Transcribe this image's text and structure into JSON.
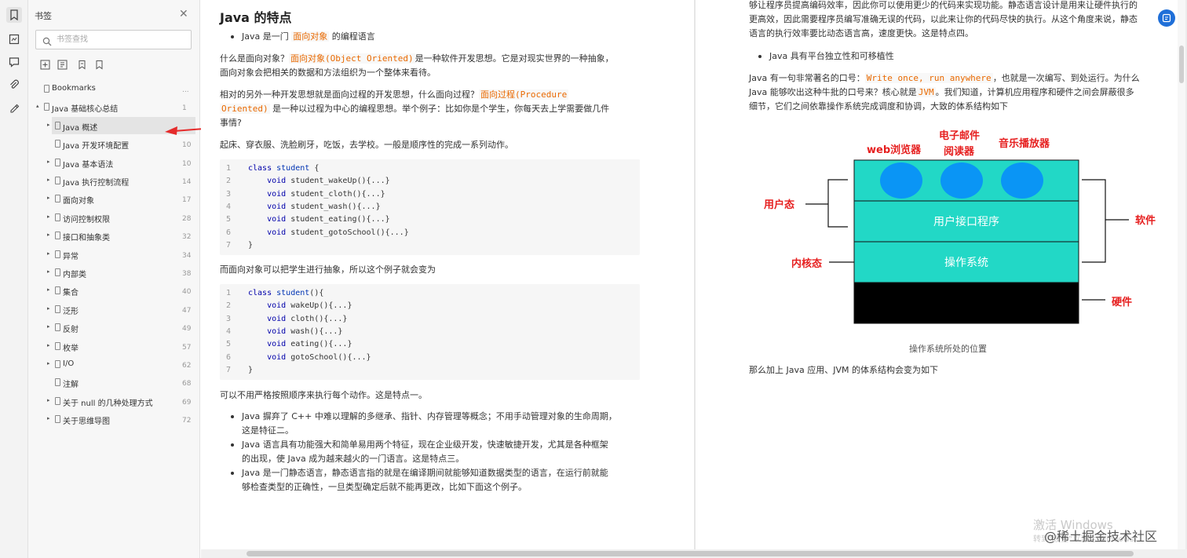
{
  "sidebar": {
    "title": "书签",
    "search_placeholder": "书签查找",
    "items": [
      {
        "label": "Bookmarks",
        "page": "...",
        "level": 0,
        "expand": ""
      },
      {
        "label": "Java 基础核心总结",
        "page": "1",
        "level": 0,
        "expand": "▴"
      },
      {
        "label": "Java 概述",
        "page": "",
        "level": 1,
        "expand": "▸",
        "selected": true
      },
      {
        "label": "Java 开发环境配置",
        "page": "10",
        "level": 1,
        "expand": ""
      },
      {
        "label": "Java 基本语法",
        "page": "10",
        "level": 1,
        "expand": "▸"
      },
      {
        "label": "Java 执行控制流程",
        "page": "14",
        "level": 1,
        "expand": "▸"
      },
      {
        "label": "面向对象",
        "page": "17",
        "level": 1,
        "expand": "▸"
      },
      {
        "label": "访问控制权限",
        "page": "28",
        "level": 1,
        "expand": "▸"
      },
      {
        "label": "接口和抽象类",
        "page": "32",
        "level": 1,
        "expand": "▸"
      },
      {
        "label": "异常",
        "page": "34",
        "level": 1,
        "expand": "▸"
      },
      {
        "label": "内部类",
        "page": "38",
        "level": 1,
        "expand": "▸"
      },
      {
        "label": "集合",
        "page": "40",
        "level": 1,
        "expand": "▸"
      },
      {
        "label": "泛形",
        "page": "47",
        "level": 1,
        "expand": "▸"
      },
      {
        "label": "反射",
        "page": "49",
        "level": 1,
        "expand": "▸"
      },
      {
        "label": "枚举",
        "page": "57",
        "level": 1,
        "expand": "▸"
      },
      {
        "label": "I/O",
        "page": "62",
        "level": 1,
        "expand": "▸"
      },
      {
        "label": "注解",
        "page": "68",
        "level": 1,
        "expand": ""
      },
      {
        "label": "关于 null 的几种处理方式",
        "page": "69",
        "level": 1,
        "expand": "▸"
      },
      {
        "label": "关于思维导图",
        "page": "72",
        "level": 1,
        "expand": "▸"
      }
    ]
  },
  "left_page": {
    "heading": "Java 的特点",
    "b1_pre": "Java 是一门",
    "b1_hi": "面向对象",
    "b1_post": "的编程语言",
    "p1_pre": "什么是面向对象？",
    "p1_hi": "面向对象(Object Oriented)",
    "p1_post": "是一种软件开发思想。它是对现实世界的一种抽象，",
    "p1_line2": "面向对象会把相关的数据和方法组织为一个整体来看待。",
    "p2_pre": "相对的另外一种开发思想就是面向过程的开发思想，什么面向过程？",
    "p2_hi1": "面向过程(Procedure",
    "p2_hi2": "Oriented)",
    "p2_post": "是一种以过程为中心的编程思想。举个例子：比如你是个学生，你每天去上学需要做几件",
    "p2_line3": "事情?",
    "p3": "起床、穿衣服、洗脸刷牙，吃饭，去学校。一般是顺序性的完成一系列动作。",
    "code1": [
      {
        "n": "1",
        "t": "class student {"
      },
      {
        "n": "2",
        "t": "    void student_wakeUp(){...}"
      },
      {
        "n": "3",
        "t": "    void student_cloth(){...}"
      },
      {
        "n": "4",
        "t": "    void student_wash(){...}"
      },
      {
        "n": "5",
        "t": "    void student_eating(){...}"
      },
      {
        "n": "6",
        "t": "    void student_gotoSchool(){...}"
      },
      {
        "n": "7",
        "t": "}"
      }
    ],
    "p4": "而面向对象可以把学生进行抽象，所以这个例子就会变为",
    "code2": [
      {
        "n": "1",
        "t": "class student(){"
      },
      {
        "n": "2",
        "t": "    void wakeUp(){...}"
      },
      {
        "n": "3",
        "t": "    void cloth(){...}"
      },
      {
        "n": "4",
        "t": "    void wash(){...}"
      },
      {
        "n": "5",
        "t": "    void eating(){...}"
      },
      {
        "n": "6",
        "t": "    void gotoSchool(){...}"
      },
      {
        "n": "7",
        "t": "}"
      }
    ],
    "p5": "可以不用严格按照顺序来执行每个动作。这是特点一。",
    "b2_l1": "Java 摒弃了 C++ 中难以理解的多继承、指针、内存管理等概念；不用手动管理对象的生命周期，",
    "b2_l2": "这是特征二。",
    "b3_l1": "Java 语言具有功能强大和简单易用两个特征，现在企业级开发，快速敏捷开发，尤其是各种框架",
    "b3_l2": "的出现，使 Java 成为越来越火的一门语言。这是特点三。",
    "b4_l1": "Java 是一门静态语言，静态语言指的就是在编译期间就能够知道数据类型的语言，在运行前就能",
    "b4_l2": "够检查类型的正确性，一旦类型确定后就不能再更改，比如下面这个例子。"
  },
  "right_page": {
    "top_l1": "够让程序员提高编码效率，因此你可以使用更少的代码来实现功能。静态语言设计是用来让硬件执行的",
    "top_l2": "更高效，因此需要程序员编写准确无误的代码，以此来让你的代码尽快的执行。从这个角度来说，静态",
    "top_l3": "语言的执行效率要比动态语言高，速度更快。这是特点四。",
    "bullet": "Java 具有平台独立性和可移植性",
    "p_pre": "Java 有一句非常著名的口号：",
    "p_hi1": "Write once, run anywhere",
    "p_mid": "，也就是一次编写、到处运行。为什么",
    "p_l2_pre": "Java 能够吹出这种牛批的口号来？核心就是",
    "p_hi2": "JVM",
    "p_l2_post": "。我们知道，计算机应用程序和硬件之间会屏蔽很多",
    "p_l3": "细节，它们之间依靠操作系统完成调度和协调，大致的体系结构如下",
    "diagram": {
      "app1": "web浏览器",
      "app2_l1": "电子邮件",
      "app2_l2": "阅读器",
      "app3": "音乐播放器",
      "layer_ui": "用户接口程序",
      "layer_os": "操作系统",
      "user_mode": "用户态",
      "kernel_mode": "内核态",
      "software": "软件",
      "hardware": "硬件",
      "color_layer": "#22d8c6",
      "color_circle": "#0a95f5",
      "color_label": "#e62020"
    },
    "caption": "操作系统所处的位置",
    "p_last": "那么加上 Java 应用、JVM 的体系结构会变为如下"
  },
  "watermark": {
    "line1": "激活 Windows",
    "line2": "转到“设置”以激活 Windows。",
    "brand": "@稀土掘金技术社区"
  }
}
